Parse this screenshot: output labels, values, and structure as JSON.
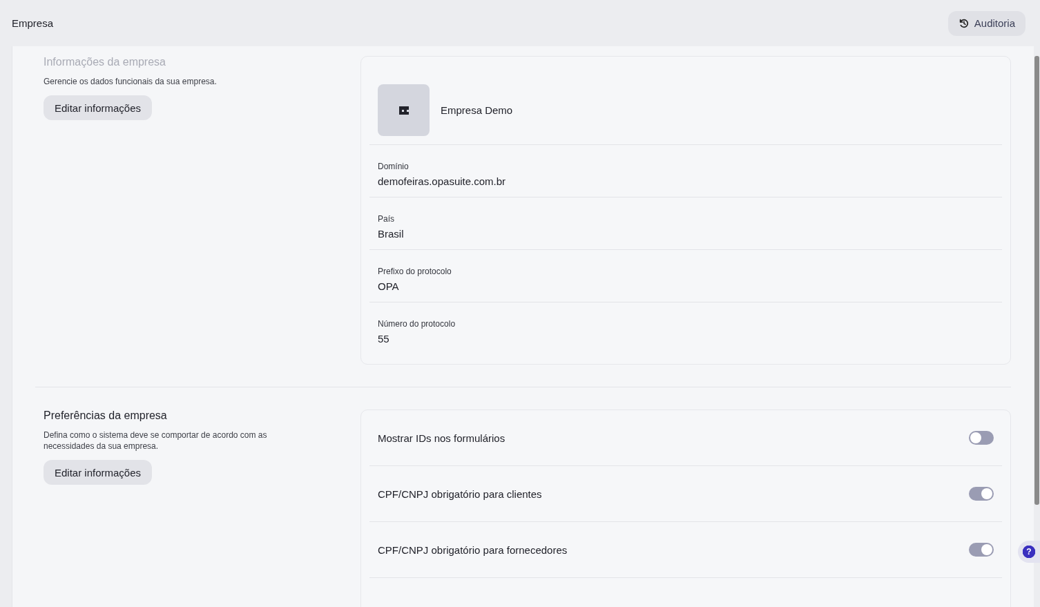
{
  "header": {
    "title": "Empresa",
    "audit_button": "Auditoria"
  },
  "company_info": {
    "title": "Informações da empresa",
    "description": "Gerencie os dados funcionais da sua empresa.",
    "edit_button": "Editar informações",
    "company_name": "Empresa Demo",
    "fields": [
      {
        "label": "Domínio",
        "value": "demofeiras.opasuite.com.br"
      },
      {
        "label": "País",
        "value": "Brasil"
      },
      {
        "label": "Prefixo do protocolo",
        "value": "OPA"
      },
      {
        "label": "Número do protocolo",
        "value": "55"
      }
    ]
  },
  "preferences": {
    "title": "Preferências da empresa",
    "description": "Defina como o sistema deve se comportar de acordo com as necessidades da sua empresa.",
    "edit_button": "Editar informações",
    "settings": [
      {
        "label": "Mostrar IDs nos formulários",
        "on": false
      },
      {
        "label": "CPF/CNPJ obrigatório para clientes",
        "on": true
      },
      {
        "label": "CPF/CNPJ obrigatório para fornecedores",
        "on": true
      }
    ]
  },
  "help_button": "?"
}
